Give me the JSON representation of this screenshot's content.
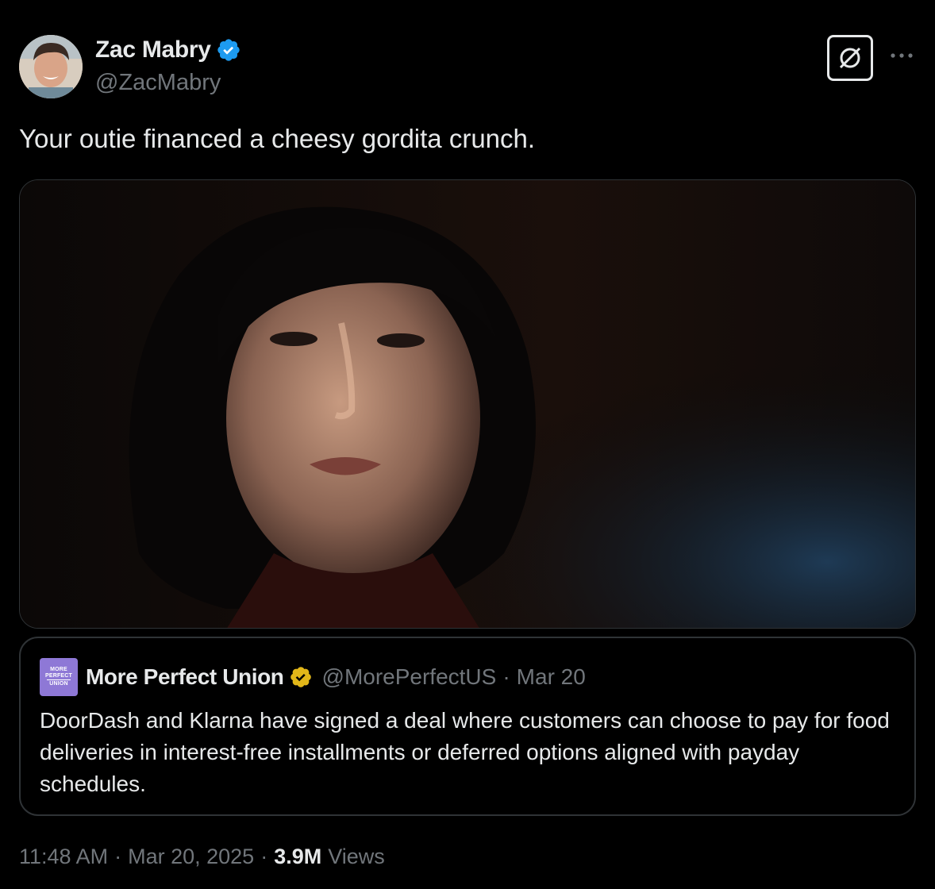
{
  "author": {
    "display_name": "Zac Mabry",
    "handle": "@ZacMabry",
    "verified_badge": "blue-check-icon"
  },
  "actions": {
    "grok_icon": "grok-icon",
    "more_icon": "more-options-icon"
  },
  "tweet": {
    "text": "Your outie financed a cheesy gordita crunch."
  },
  "media": {
    "kind": "photo"
  },
  "quote": {
    "logo_lines": [
      "MORE",
      "PERFECT",
      "UNION"
    ],
    "display_name": "More Perfect Union",
    "verified_badge": "gold-check-icon",
    "handle": "@MorePerfectUS",
    "separator": "·",
    "date": "Mar 20",
    "text": "DoorDash and Klarna have signed a deal where customers can choose to pay for food deliveries in  interest-free installments or deferred options aligned with payday schedules."
  },
  "meta": {
    "time": "11:48 AM",
    "separator": "·",
    "date": "Mar 20, 2025",
    "views_count": "3.9M",
    "views_label": "Views"
  },
  "colors": {
    "background": "#000000",
    "text_primary": "#e7e9ea",
    "text_secondary": "#71767b",
    "border": "#2f3336",
    "verified_blue": "#1d9bf0",
    "verified_gold": "#e2b719",
    "org_logo": "#8e78d6"
  }
}
